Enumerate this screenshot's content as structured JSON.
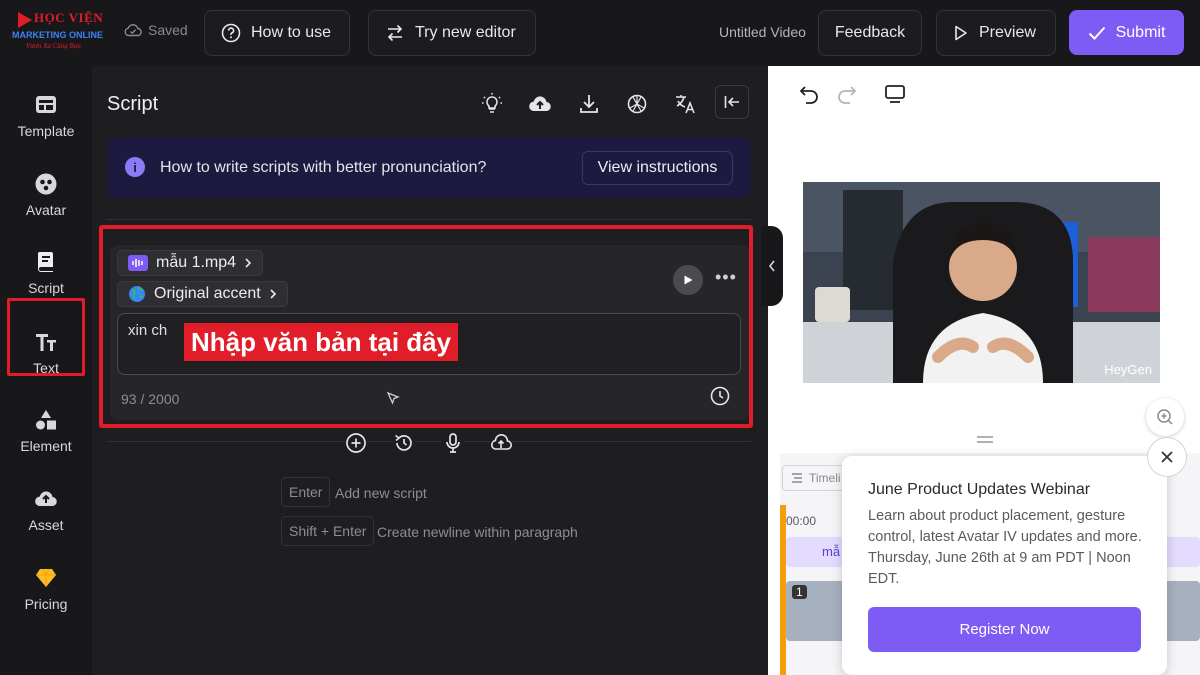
{
  "brand": {
    "line1": "HỌC VIỆN",
    "line2": "MARKETING ONLINE",
    "line3": "Vươn Xa Cùng Bạn"
  },
  "header": {
    "saved_label": "Saved",
    "how_to_use": "How to use",
    "try_editor": "Try new editor",
    "video_title": "Untitled Video",
    "feedback": "Feedback",
    "preview": "Preview",
    "submit": "Submit"
  },
  "sidebar": {
    "items": [
      {
        "label": "Template",
        "icon": "template-icon"
      },
      {
        "label": "Avatar",
        "icon": "avatar-icon"
      },
      {
        "label": "Script",
        "icon": "script-icon"
      },
      {
        "label": "Text",
        "icon": "text-icon"
      },
      {
        "label": "Element",
        "icon": "element-icon"
      },
      {
        "label": "Asset",
        "icon": "asset-icon"
      },
      {
        "label": "Pricing",
        "icon": "diamond-icon"
      }
    ],
    "active": "Script"
  },
  "script": {
    "title": "Script",
    "banner_text": "How to write scripts with better pronunciation?",
    "view_instructions": "View instructions",
    "voice_file": "mẫu 1.mp4",
    "accent": "Original accent",
    "text_value": "xin ch",
    "overlay_label": "Nhập văn bản tại đây",
    "char_count": "93 / 2000",
    "shortcut_enter_key": "Enter",
    "shortcut_enter_desc": "Add new script",
    "shortcut_shift_key": "Shift + Enter",
    "shortcut_shift_desc": "Create newline within paragraph"
  },
  "preview": {
    "watermark": "HeyGen",
    "timeline_label": "Timeli",
    "time_start": "00:00",
    "scene_number": "1",
    "track_label": "mẫ"
  },
  "popup": {
    "title": "June Product Updates Webinar",
    "body": "Learn about product placement, gesture control, latest Avatar IV updates and more. Thursday, June 26th at 9 am PDT | Noon EDT.",
    "cta": "Register Now"
  },
  "colors": {
    "accent": "#7c5cf5",
    "highlight": "#e11d2a",
    "background": "#18181b"
  }
}
